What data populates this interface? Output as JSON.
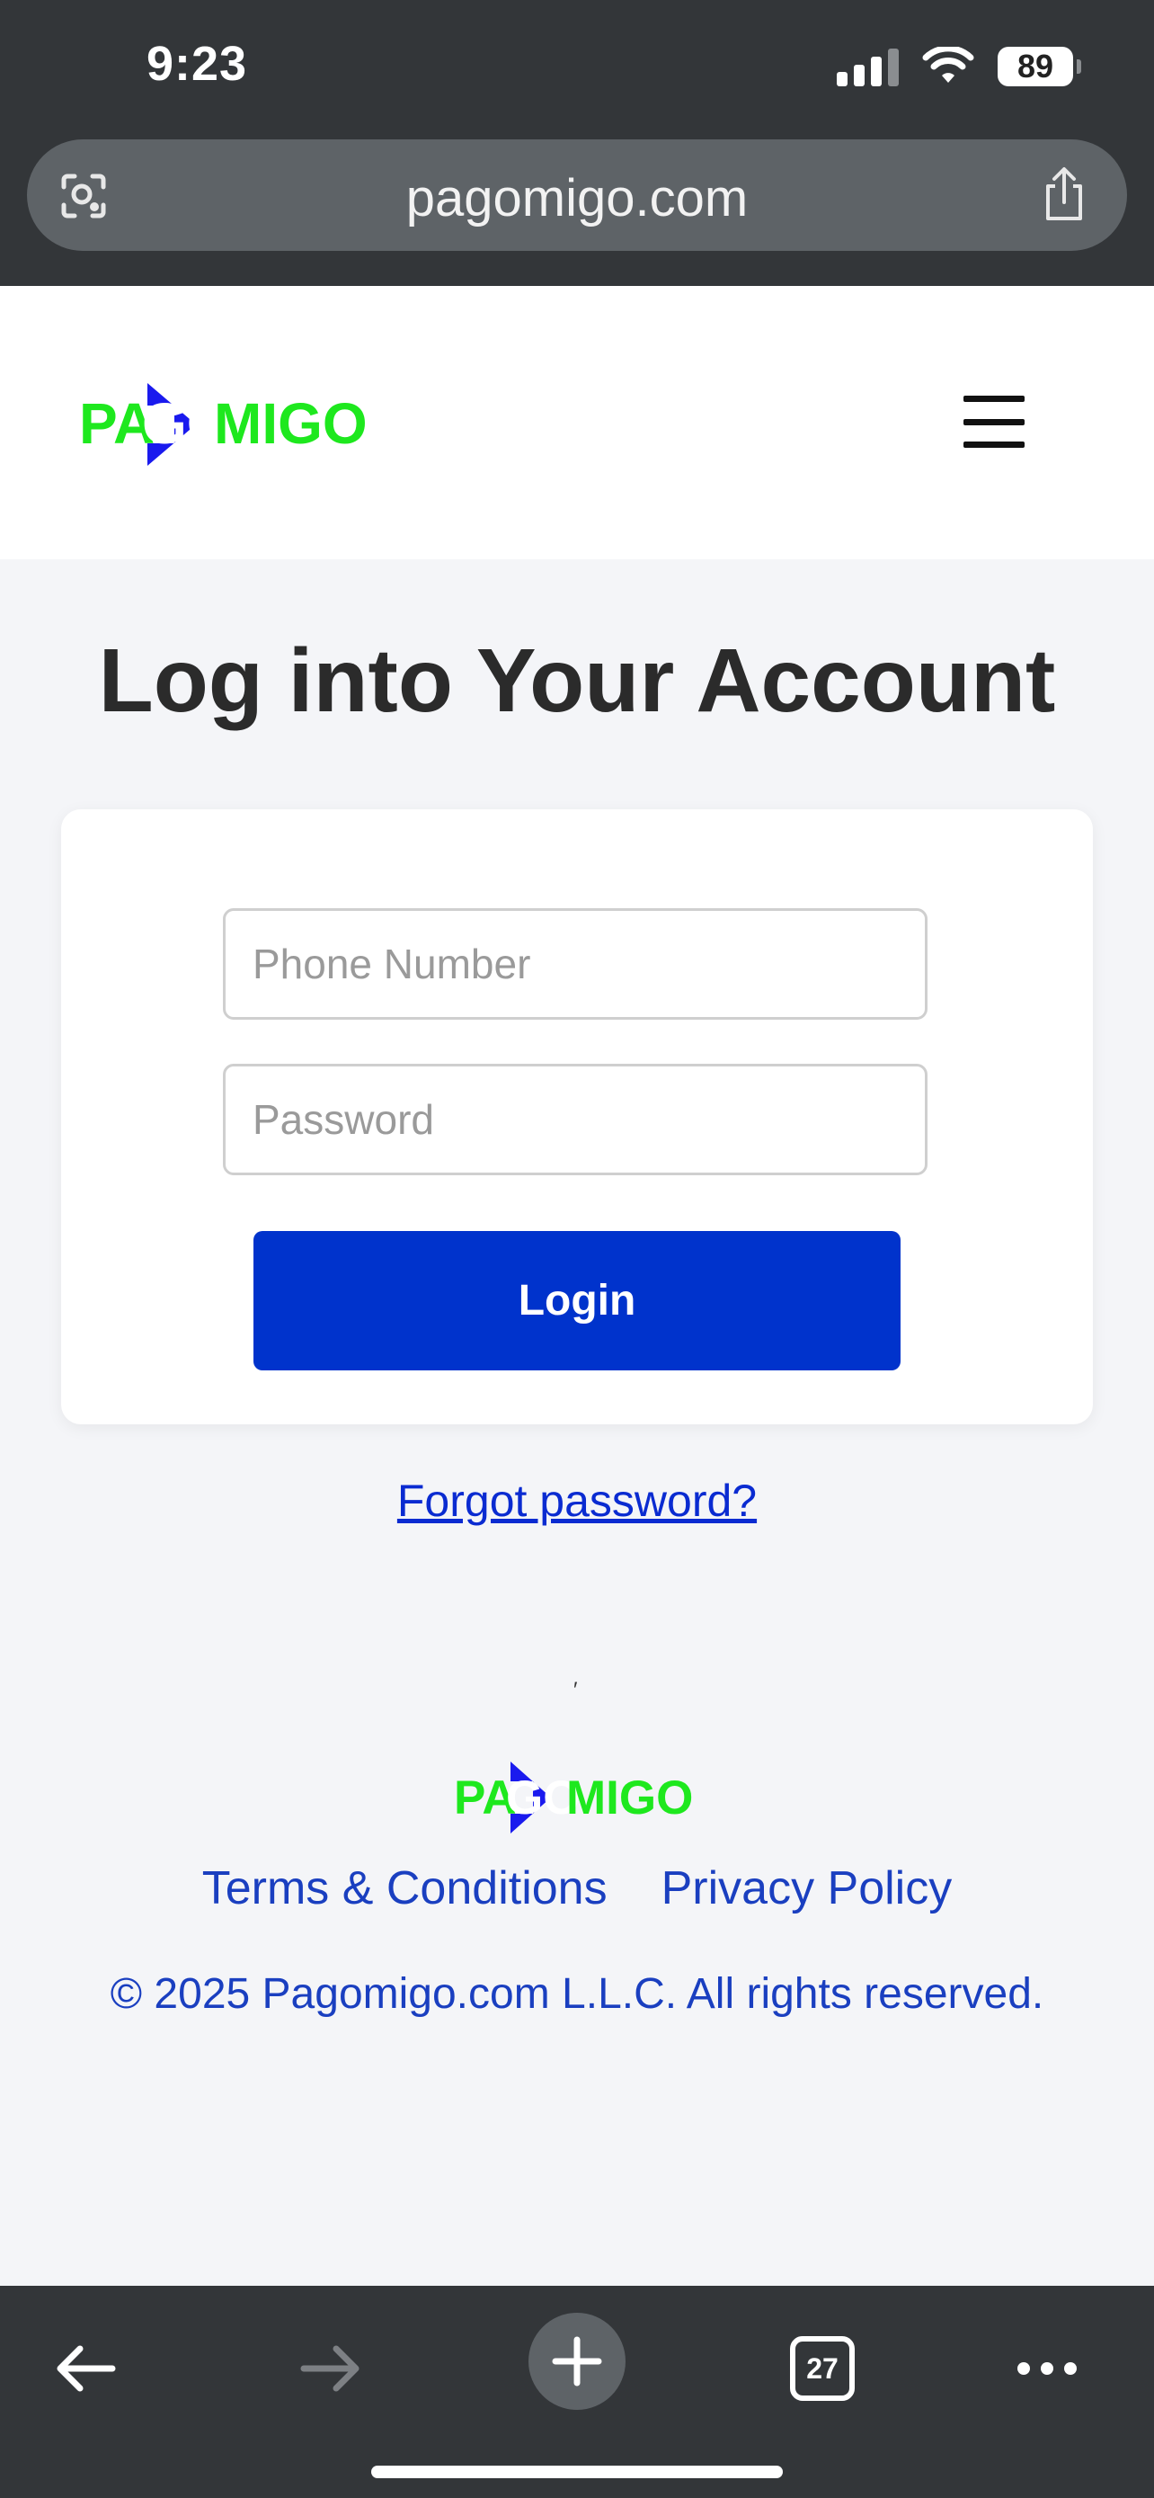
{
  "status_bar": {
    "time": "9:23",
    "battery": "89"
  },
  "browser": {
    "url": "pagomigo.com",
    "tab_count": "27"
  },
  "header": {
    "logo_alt": "PAGOMIGO",
    "logo_parts": {
      "pa": "PA",
      "go": "GO",
      "migo": "MIGO"
    }
  },
  "main": {
    "title": "Log into Your Account",
    "phone_placeholder": "Phone Number",
    "password_placeholder": "Password",
    "login_label": "Login",
    "forgot_label": "Forgot password?",
    "stray_mark": "′"
  },
  "footer": {
    "terms_label": "Terms & Conditions",
    "privacy_label": "Privacy Policy",
    "copyright": "© 2025 Pagomigo.com L.L.C. All rights reserved."
  },
  "colors": {
    "brand_green": "#1ee81e",
    "brand_blue": "#1a1aee",
    "button_blue": "#0033cc",
    "link_blue": "#1a3fc0"
  },
  "icons": [
    "visual-lookup-icon",
    "share-icon",
    "hamburger-menu-icon",
    "back-arrow-icon",
    "forward-arrow-icon",
    "plus-icon",
    "tabs-icon",
    "more-icon"
  ]
}
